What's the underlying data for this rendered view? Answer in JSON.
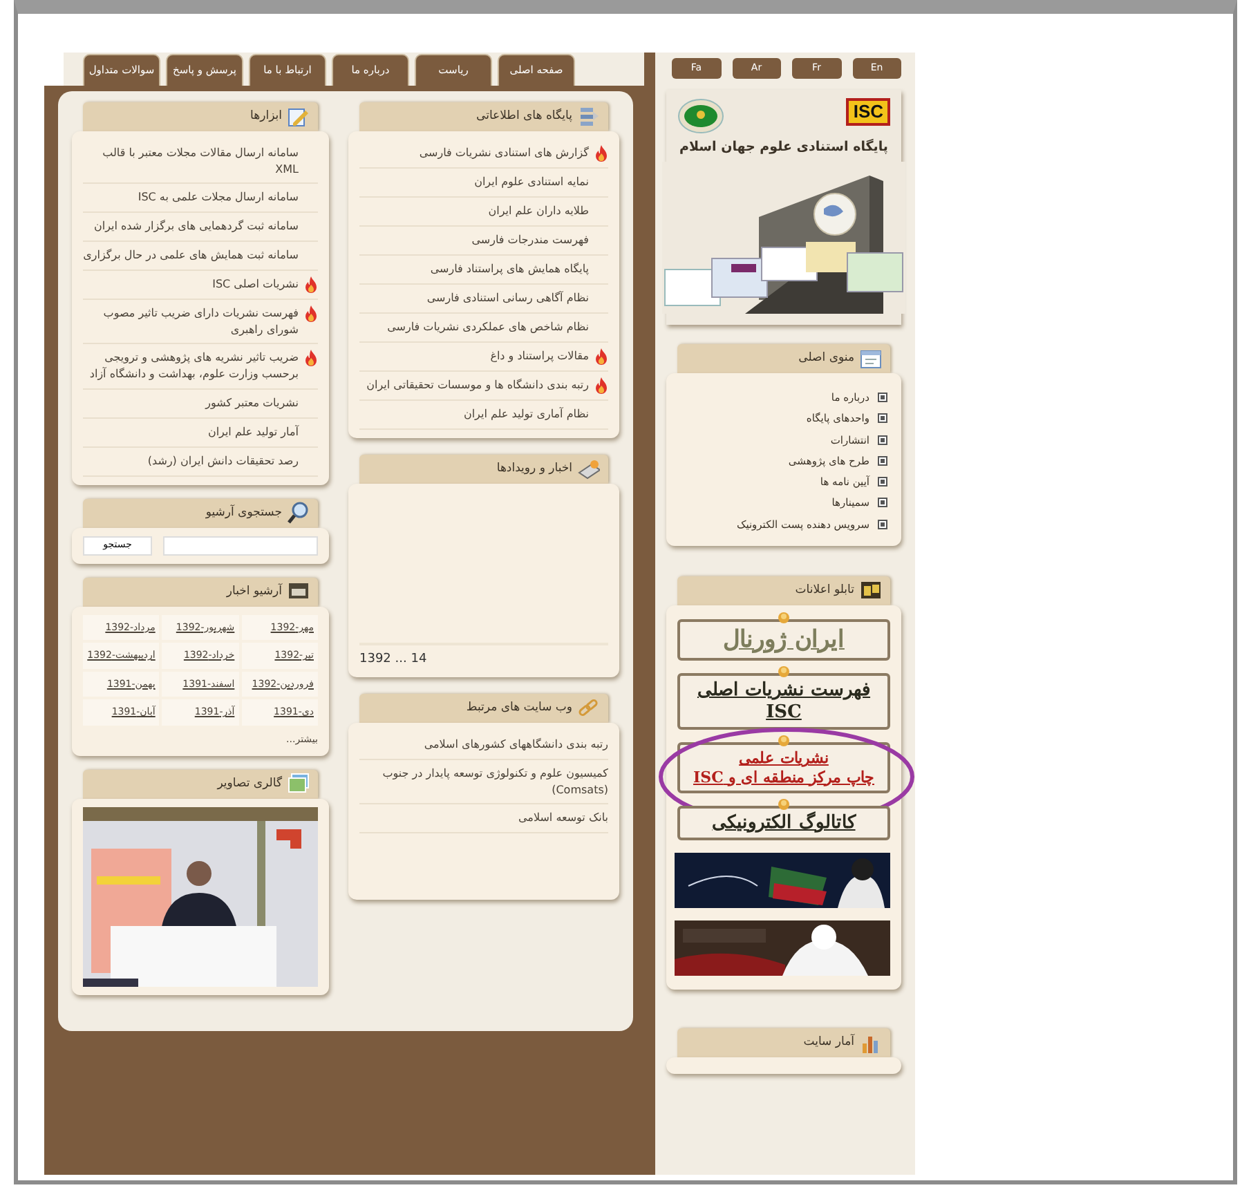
{
  "language_buttons": [
    "En",
    "Fr",
    "Ar",
    "Fa"
  ],
  "tabs": [
    {
      "label": "صفحه اصلی",
      "selected": false
    },
    {
      "label": "ریاست",
      "selected": false
    },
    {
      "label": "درباره ما",
      "selected": false
    },
    {
      "label": "ارتباط با ما",
      "selected": false
    },
    {
      "label": "پرسش و پاسخ",
      "selected": false
    },
    {
      "label": "سوالات متداول",
      "selected": false
    }
  ],
  "header": {
    "logo": "ISC",
    "title": "پایگاه استنادی علوم جهان اسلام"
  },
  "main_menu": {
    "title": "منوی اصلی",
    "items": [
      "درباره ما",
      "واحدهای پایگاه",
      "انتشارات",
      "طرح های پژوهشی",
      "آیین نامه ها",
      "سمینارها",
      "سرویس دهنده پست الکترونیک"
    ]
  },
  "notice_board": {
    "title": "تابلو اعلانات",
    "links": [
      {
        "lines": [
          "ایران ژورنال"
        ],
        "color": "#7d7d5c",
        "highlighted": false
      },
      {
        "lines": [
          "فهرست نشریات اصلی ISC"
        ],
        "color": "#2a2a1e",
        "highlighted": false
      },
      {
        "lines": [
          "نشریات علمی",
          "چاپ مرکز منطقه ای و ISC"
        ],
        "color": "#b3201c",
        "highlighted": true
      },
      {
        "lines": [
          "کاتالوگ الکترونیکی"
        ],
        "color": "#2a2a1e",
        "highlighted": false
      }
    ]
  },
  "site_stats": {
    "title": "آمار سایت"
  },
  "databases": {
    "title": "پایگاه های اطلاعاتی",
    "items": [
      {
        "label": "گزارش های استنادی نشریات فارسی",
        "hot": true
      },
      {
        "label": "نمایه استنادی علوم ایران",
        "hot": false
      },
      {
        "label": "طلایه داران علم ایران",
        "hot": false
      },
      {
        "label": "فهرست مندرجات فارسی",
        "hot": false
      },
      {
        "label": "پایگاه همایش های پراستناد فارسی",
        "hot": false
      },
      {
        "label": "نظام آگاهی رسانی استنادی فارسی",
        "hot": false
      },
      {
        "label": "نظام شاخص های عملکردی نشریات فارسی",
        "hot": false
      },
      {
        "label": "مقالات پراستناد و داغ",
        "hot": true
      },
      {
        "label": "رتبه بندی دانشگاه ها و موسسات تحقیقاتی ایران",
        "hot": true
      },
      {
        "label": "نظام آماری تولید علم ایران",
        "hot": false
      }
    ]
  },
  "tools": {
    "title": "ابزارها",
    "items": [
      {
        "label": "سامانه ارسال مقالات مجلات معتبر با قالب XML",
        "hot": false
      },
      {
        "label": "سامانه ارسال مجلات علمی به ISC",
        "hot": false
      },
      {
        "label": "سامانه ثبت گردهمایی های برگزار شده ایران",
        "hot": false
      },
      {
        "label": "سامانه ثبت همایش های علمی در حال برگزاری",
        "hot": false
      },
      {
        "label": "نشریات اصلی ISC",
        "hot": true
      },
      {
        "label": "فهرست نشریات دارای ضریب تاثیر مصوب شورای راهبری",
        "hot": true
      },
      {
        "label": "ضریب تاثیر نشریه های پژوهشی و ترویجی برحسب وزارت علوم، بهداشت و دانشگاه آزاد",
        "hot": true
      },
      {
        "label": "نشریات معتبر کشور",
        "hot": false
      },
      {
        "label": "آمار تولید علم ایران",
        "hot": false
      },
      {
        "label": "رصد تحقیقات دانش ایران (رشد)",
        "hot": false
      }
    ]
  },
  "news": {
    "title": "اخبار و رویدادها",
    "date": "14 ... 1392"
  },
  "archive_search": {
    "title": "جستجوی آرشیو",
    "button": "جستجو"
  },
  "news_archive": {
    "title": "آرشیو اخبار",
    "months": [
      "مهر-1392",
      "شهریور-1392",
      "مرداد-1392",
      "تیر-1392",
      "خرداد-1392",
      "اردیبهشت-1392",
      "فروردین-1392",
      "اسفند-1391",
      "بهمن-1391",
      "دی-1391",
      "آذر-1391",
      "آبان-1391"
    ],
    "more": "بیشتر..."
  },
  "related_sites": {
    "title": "وب سایت های مرتبط",
    "items": [
      "رتبه بندی دانشگاههای کشورهای اسلامی",
      "کمیسیون علوم و تکنولوژی توسعه پایدار در جنوب (Comsats)",
      "بانک توسعه اسلامی"
    ]
  },
  "gallery": {
    "title": "گالری تصاویر"
  }
}
